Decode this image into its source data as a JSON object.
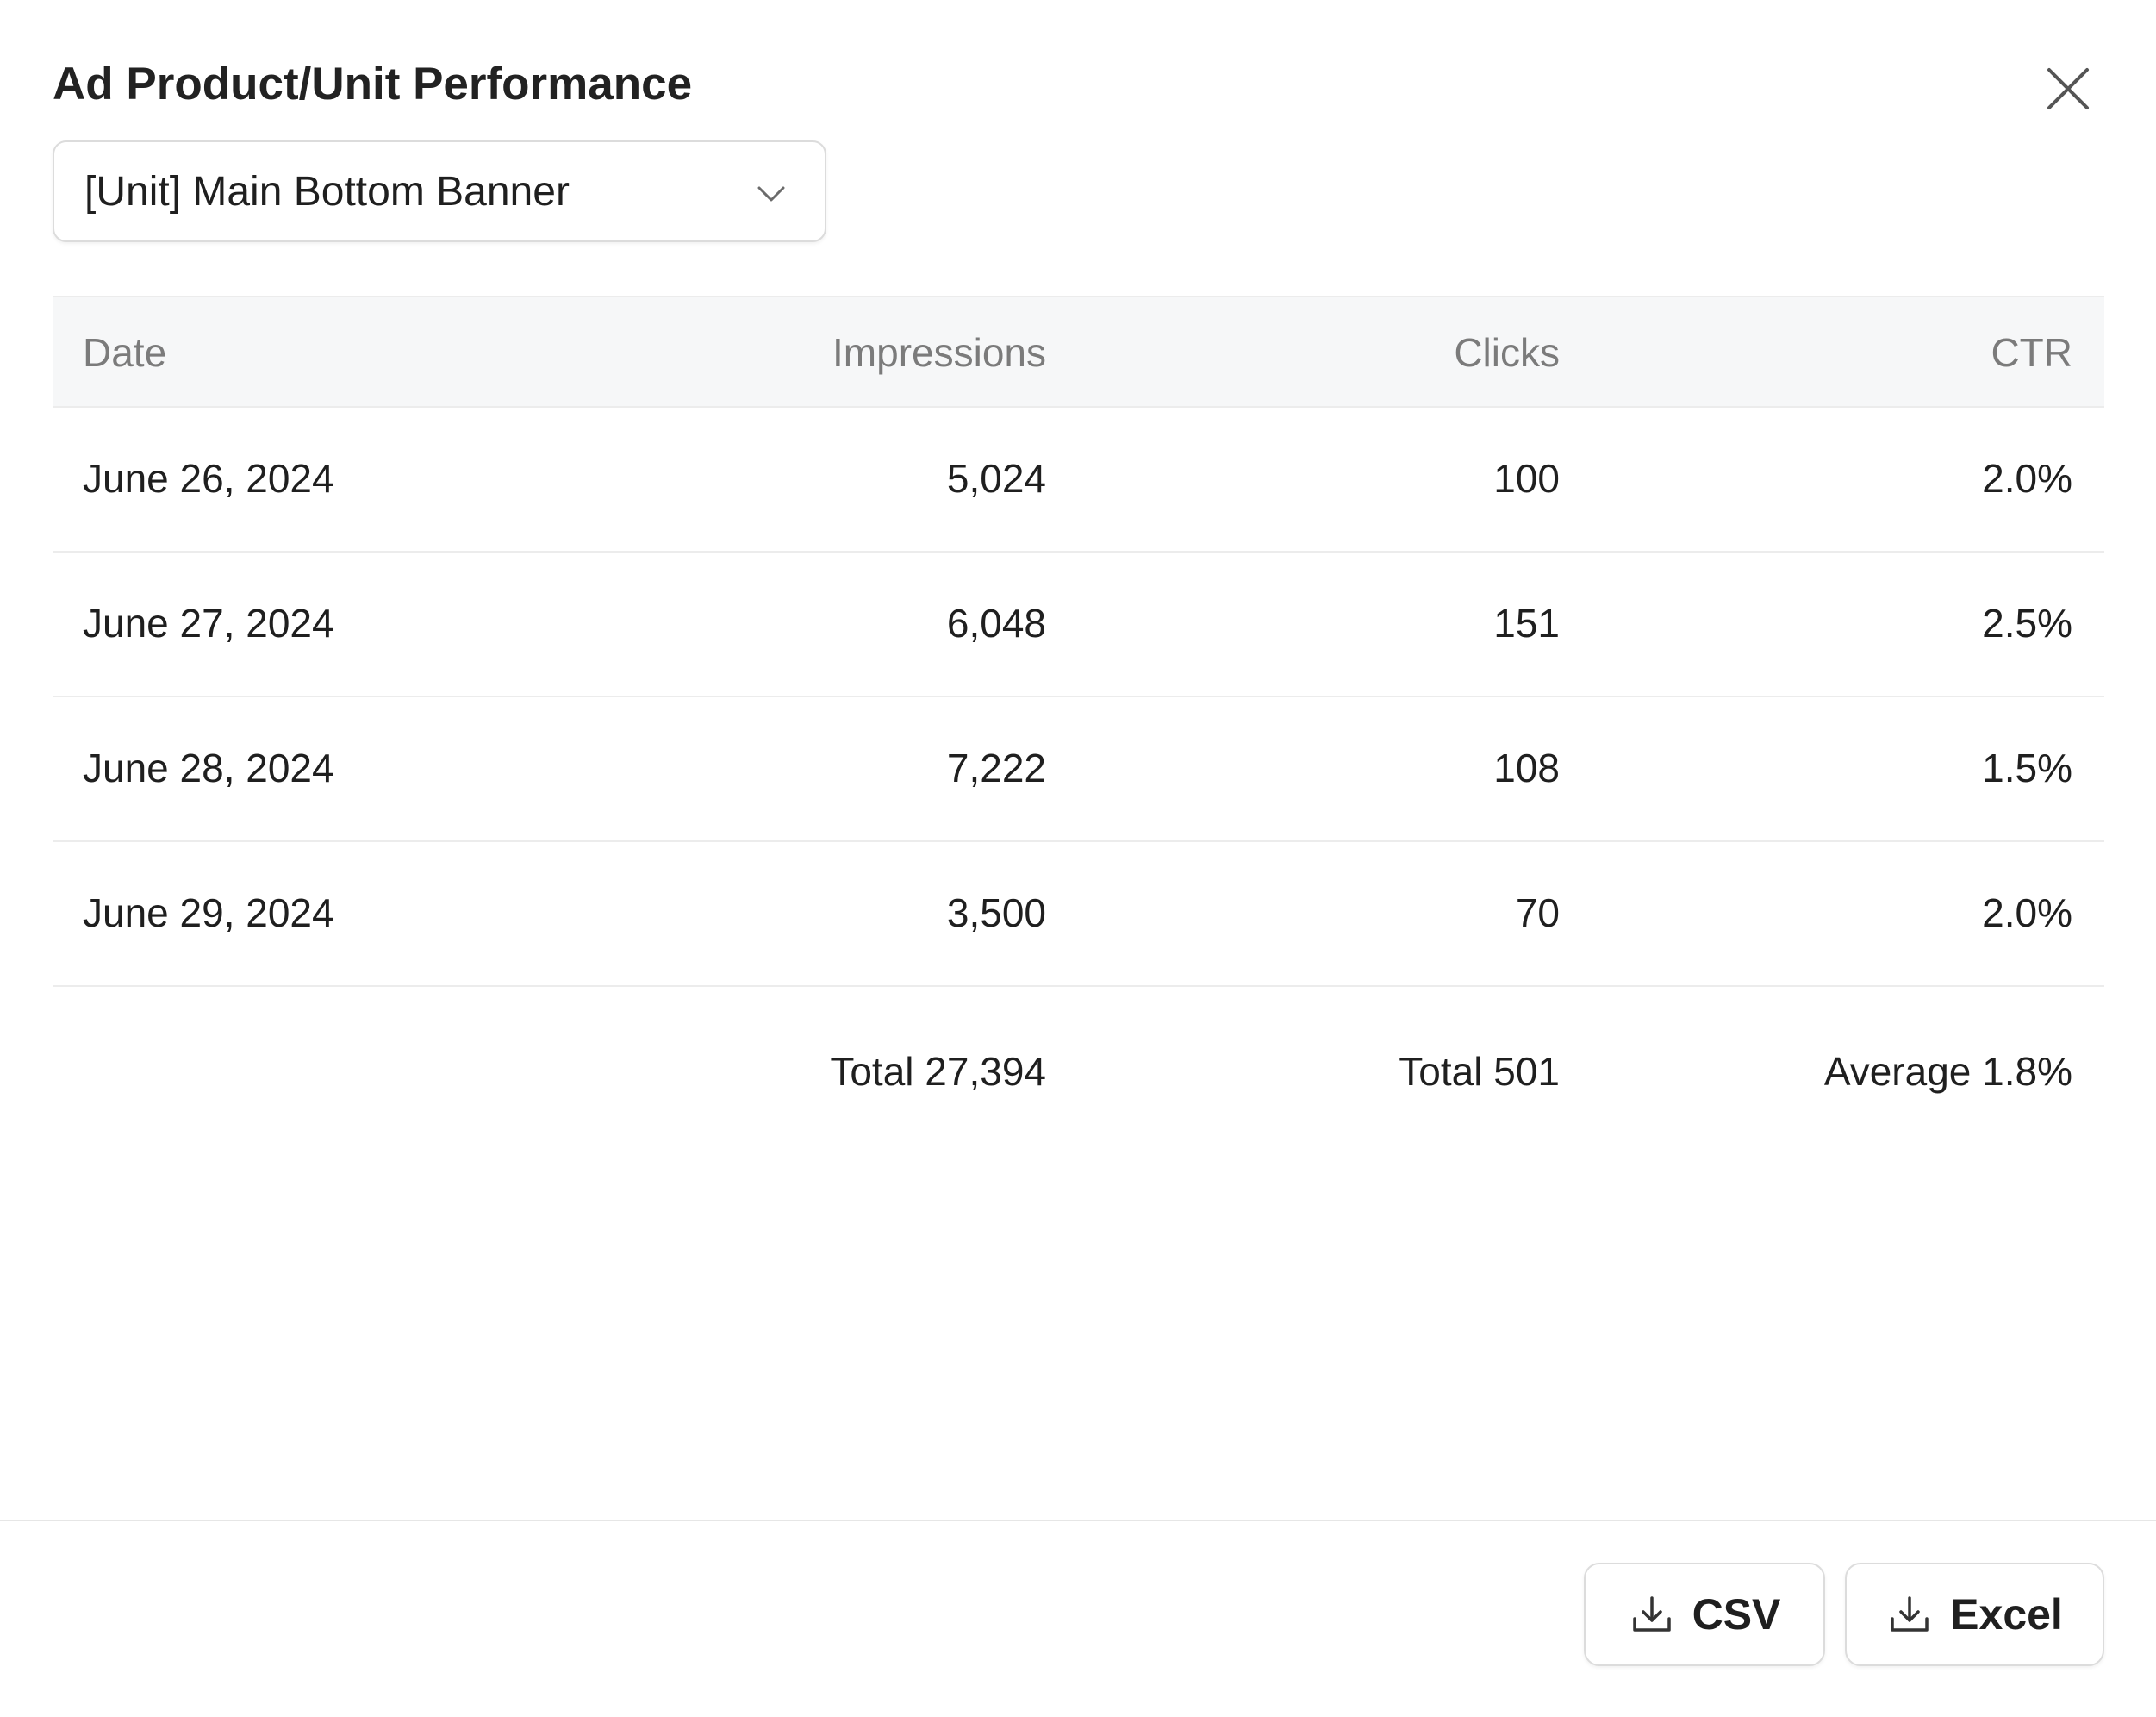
{
  "dialog": {
    "title": "Ad Product/Unit Performance"
  },
  "selector": {
    "value": "[Unit] Main Bottom Banner"
  },
  "table": {
    "headers": {
      "date": "Date",
      "impressions": "Impressions",
      "clicks": "Clicks",
      "ctr": "CTR"
    },
    "rows": [
      {
        "date": "June 26, 2024",
        "impressions": "5,024",
        "clicks": "100",
        "ctr": "2.0%"
      },
      {
        "date": "June 27, 2024",
        "impressions": "6,048",
        "clicks": "151",
        "ctr": "2.5%"
      },
      {
        "date": "June 28, 2024",
        "impressions": "7,222",
        "clicks": "108",
        "ctr": "1.5%"
      },
      {
        "date": "June 29, 2024",
        "impressions": "3,500",
        "clicks": "70",
        "ctr": "2.0%"
      }
    ],
    "totals": {
      "impressions": "Total 27,394",
      "clicks": "Total 501",
      "ctr": "Average 1.8%"
    }
  },
  "footer": {
    "csv_label": "CSV",
    "excel_label": "Excel"
  },
  "icons": {
    "close": "close-icon",
    "chevron": "chevron-down-icon",
    "download": "download-icon"
  },
  "colors": {
    "header_bg": "#f6f7f8",
    "border": "#ececec",
    "muted_text": "#7b7b7b",
    "text": "#1f1f1f"
  }
}
